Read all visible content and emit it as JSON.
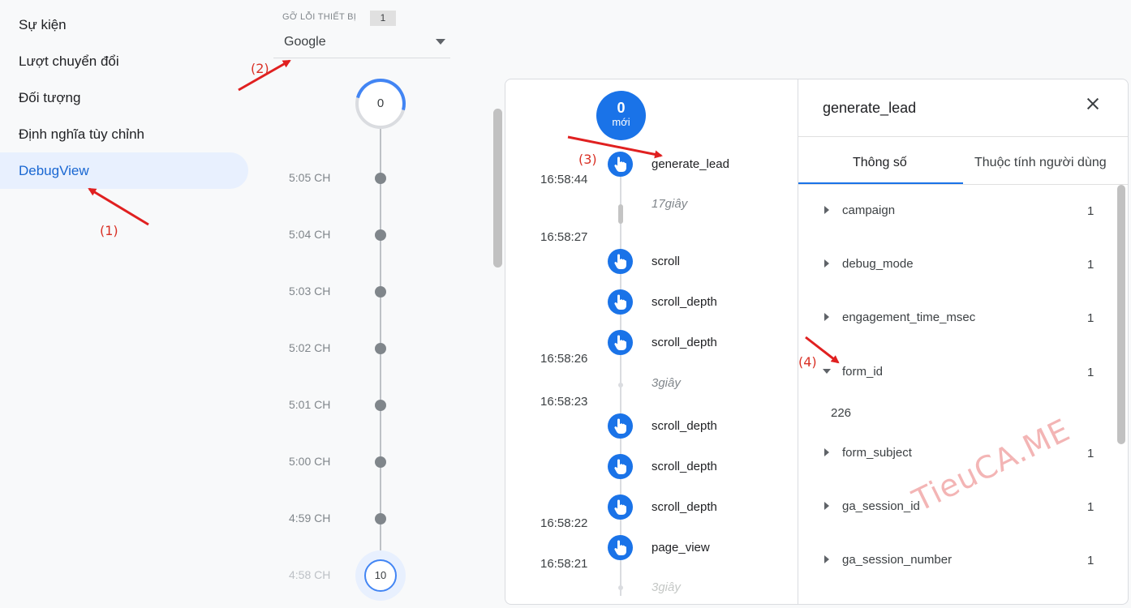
{
  "nav": {
    "items": [
      {
        "label": "Sự kiện"
      },
      {
        "label": "Lượt chuyển đổi"
      },
      {
        "label": "Đối tượng"
      },
      {
        "label": "Định nghĩa tùy chỉnh"
      },
      {
        "label": "DebugView"
      }
    ],
    "active_index": 4
  },
  "device": {
    "label": "GỠ LỖI THIẾT BỊ",
    "count": "1",
    "selected": "Google"
  },
  "minutes": {
    "top_count": "0",
    "labels": [
      "5:05 CH",
      "5:04 CH",
      "5:03 CH",
      "5:02 CH",
      "5:01 CH",
      "5:00 CH",
      "4:59 CH",
      "4:58 CH"
    ],
    "bottom_count": "10"
  },
  "stream": {
    "new_count": "0",
    "new_label": "mới",
    "events": [
      {
        "name": "generate_lead"
      },
      {
        "name": "scroll"
      },
      {
        "name": "scroll_depth"
      },
      {
        "name": "scroll_depth"
      },
      {
        "name": "scroll_depth"
      },
      {
        "name": "scroll_depth"
      },
      {
        "name": "scroll_depth"
      },
      {
        "name": "page_view"
      }
    ],
    "times": [
      "16:58:44",
      "16:58:27",
      "16:58:26",
      "16:58:23",
      "16:58:22",
      "16:58:21"
    ],
    "gaps": [
      "17giây",
      "3giây",
      "3giây"
    ]
  },
  "detail": {
    "title": "generate_lead",
    "tabs": [
      {
        "label": "Thông số"
      },
      {
        "label": "Thuộc tính người dùng"
      }
    ],
    "active_tab": 0,
    "params": [
      {
        "name": "campaign",
        "count": "1"
      },
      {
        "name": "debug_mode",
        "count": "1"
      },
      {
        "name": "engagement_time_msec",
        "count": "1"
      },
      {
        "name": "form_id",
        "count": "1",
        "expanded": true,
        "value": "226"
      },
      {
        "name": "form_subject",
        "count": "1"
      },
      {
        "name": "ga_session_id",
        "count": "1"
      },
      {
        "name": "ga_session_number",
        "count": "1"
      }
    ]
  },
  "annotations": [
    "(1)",
    "(2)",
    "(3)",
    "(4)"
  ],
  "watermark": "TieuCA.ME",
  "colors": {
    "accent": "#1a73e8",
    "annotation": "#d93025",
    "nav_active_bg": "#e8f0fe"
  }
}
